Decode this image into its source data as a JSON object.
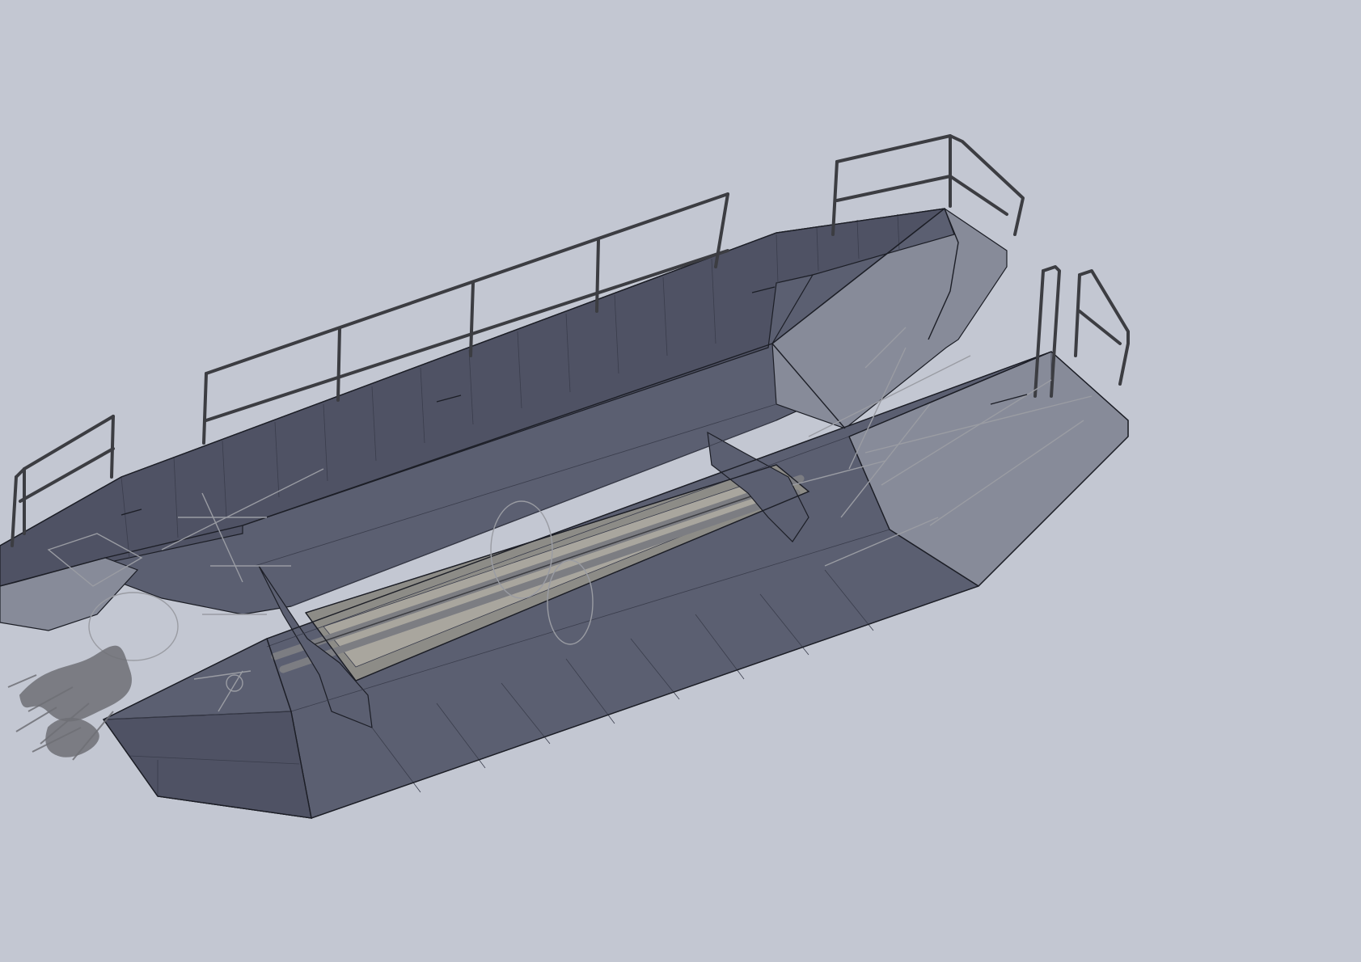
{
  "viewport": {
    "background": "#c3c7d2"
  },
  "model": {
    "hull_dark": "#4f5264",
    "hull_mid": "#5b5f71",
    "hull_light": "#878b99",
    "deck_panel": "#8d8c87",
    "deck_panel_light": "#a9a69e",
    "edge": "#1c1e26",
    "seam": "#3a3d4c",
    "railing": "#7c7d82",
    "railing_dark": "#3c3d42",
    "sketch_lines": "#9a9ca3",
    "sketch_dark": "#6f7076"
  }
}
